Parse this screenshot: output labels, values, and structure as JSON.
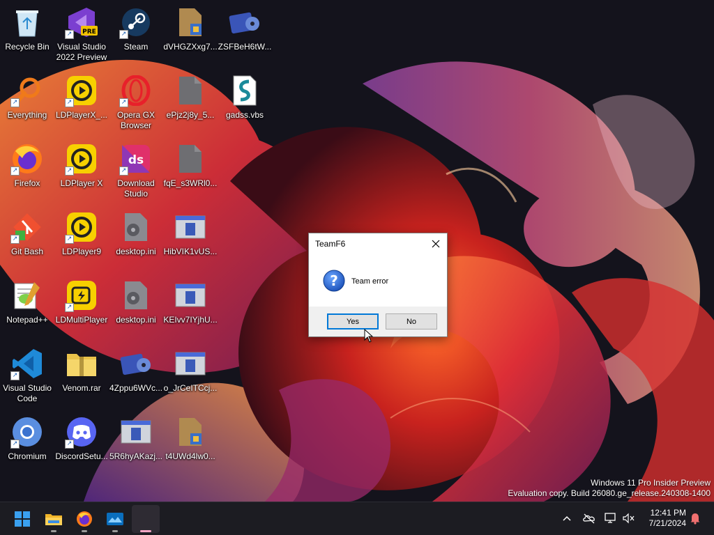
{
  "desktop": {
    "icons": [
      {
        "label": "Recycle Bin"
      },
      {
        "label": "Visual Studio 2022 Preview",
        "badge": "PRE"
      },
      {
        "label": "Steam"
      },
      {
        "label": "dVHGZXxg7..."
      },
      {
        "label": "ZSFBeH6tW..."
      },
      {
        "label": "Everything"
      },
      {
        "label": "LDPlayerX_..."
      },
      {
        "label": "Opera GX Browser"
      },
      {
        "label": "ePjz2j8y_5..."
      },
      {
        "label": "gadss.vbs"
      },
      {
        "label": "Firefox"
      },
      {
        "label": "LDPlayer X"
      },
      {
        "label": "Download Studio"
      },
      {
        "label": "fqE_s3WRl0..."
      },
      {
        "label": "Git Bash"
      },
      {
        "label": "LDPlayer9"
      },
      {
        "label": "desktop.ini"
      },
      {
        "label": "HibVIK1vUS..."
      },
      {
        "label": "Notepad++"
      },
      {
        "label": "LDMultiPlayer"
      },
      {
        "label": "desktop.ini"
      },
      {
        "label": "KEIvv7IYjhU..."
      },
      {
        "label": "Visual Studio Code"
      },
      {
        "label": "Venom.rar"
      },
      {
        "label": "4Zppu6WVc..."
      },
      {
        "label": "o_JrCeITCcj..."
      },
      {
        "label": "Chromium"
      },
      {
        "label": "DiscordSetu..."
      },
      {
        "label": "5R6hyAKazj..."
      },
      {
        "label": "t4UWd4lw0..."
      }
    ]
  },
  "dialog": {
    "title": "TeamF6",
    "message": "Team error",
    "icon": "question-icon",
    "yes_label": "Yes",
    "no_label": "No"
  },
  "watermark": {
    "line1": "Windows 11 Pro Insider Preview",
    "line2": "Evaluation copy. Build 26080.ge_release.240308-1400"
  },
  "taskbar": {
    "apps": [
      "start-icon",
      "file-explorer-icon",
      "firefox-icon",
      "photos-icon",
      "running-app-icon"
    ],
    "clock": {
      "time": "12:41 PM",
      "date": "7/21/2024"
    }
  },
  "colors": {
    "accent": "#0078d7",
    "taskbar": "#1c1c22",
    "wallpaper_bg": "#12111a"
  }
}
